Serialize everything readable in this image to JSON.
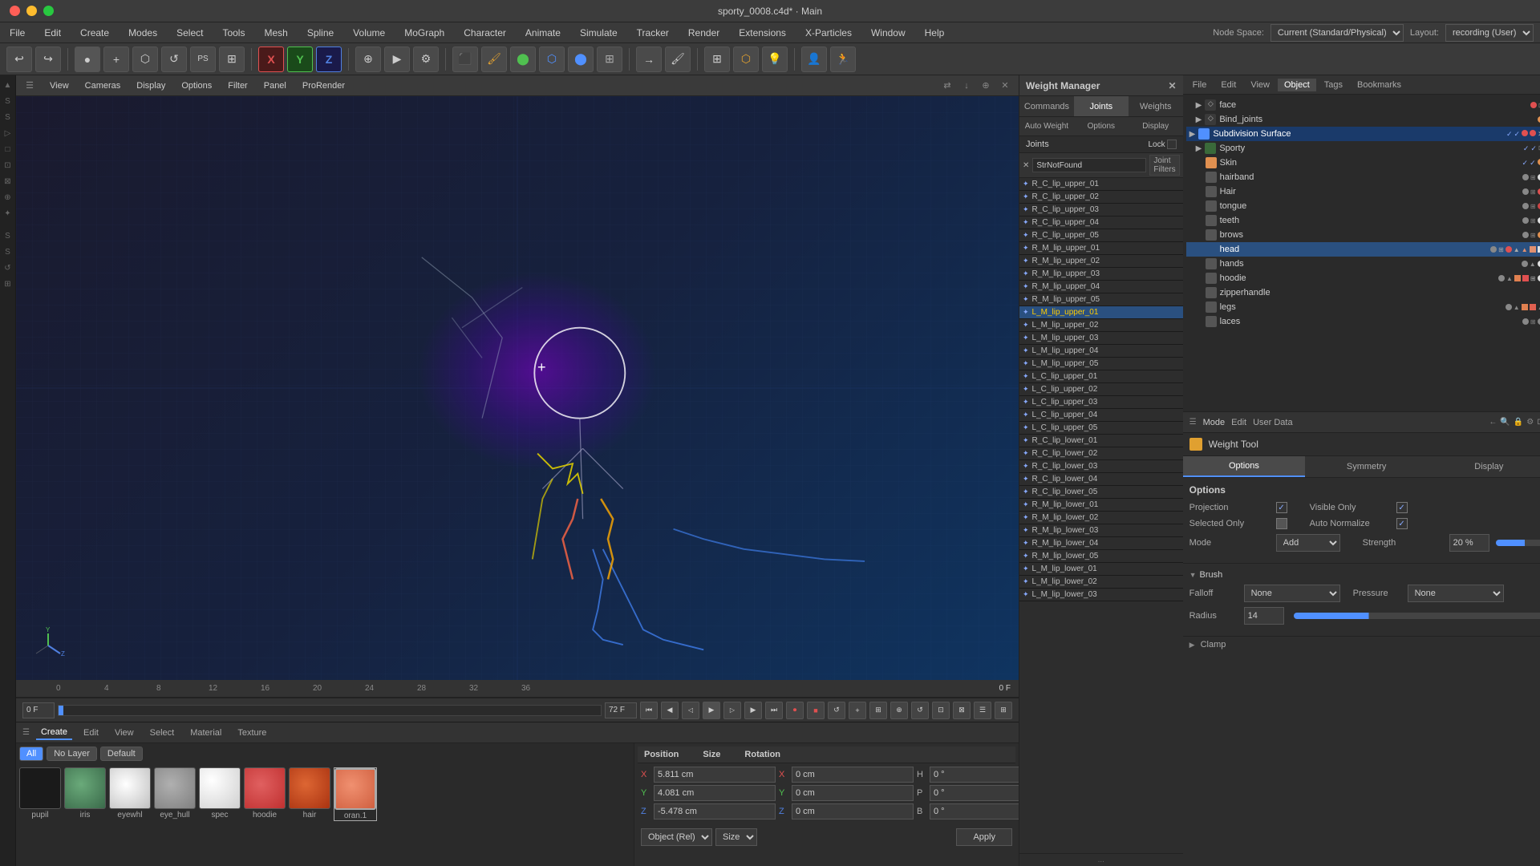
{
  "titleBar": {
    "title": "sporty_0008.c4d* · Main"
  },
  "menuBar": {
    "items": [
      "File",
      "Edit",
      "Create",
      "Modes",
      "Select",
      "Tools",
      "Mesh",
      "Spline",
      "Volume",
      "MoGraph",
      "Character",
      "Animate",
      "Simulate",
      "Tracker",
      "Render",
      "Extensions",
      "X-Particles",
      "Window",
      "Help"
    ],
    "nodeSpaceLabel": "Node Space:",
    "nodeSpaceValue": "Current (Standard/Physical)",
    "layoutLabel": "Layout:",
    "layoutValue": "recording (User)"
  },
  "viewport": {
    "menuItems": [
      "View",
      "Cameras",
      "Display",
      "Options",
      "Filter",
      "Panel",
      "ProRender"
    ],
    "frameIndicator": "0 F"
  },
  "weightManager": {
    "title": "Weight Manager",
    "tabs": [
      "Commands",
      "Joints",
      "Weights"
    ],
    "activeTab": "Joints",
    "subTabs": [
      "Auto Weight",
      "Options",
      "Display"
    ],
    "jointsLabel": "Joints",
    "lockLabel": "Lock",
    "filterPlaceholder": "StrNotFound",
    "jointFilterBtn": "Joint Filters",
    "joints": [
      "R_C_lip_upper_01",
      "R_C_lip_upper_02",
      "R_C_lip_upper_03",
      "R_C_lip_upper_04",
      "R_C_lip_upper_05",
      "R_M_lip_upper_01",
      "R_M_lip_upper_02",
      "R_M_lip_upper_03",
      "R_M_lip_upper_04",
      "R_M_lip_upper_05",
      "L_M_lip_upper_01",
      "L_M_lip_upper_02",
      "L_M_lip_upper_03",
      "L_M_lip_upper_04",
      "L_M_lip_upper_05",
      "L_C_lip_upper_01",
      "L_C_lip_upper_02",
      "L_C_lip_upper_03",
      "L_C_lip_upper_04",
      "L_C_lip_upper_05",
      "R_C_lip_lower_01",
      "R_C_lip_lower_02",
      "R_C_lip_lower_03",
      "R_C_lip_lower_04",
      "R_C_lip_lower_05",
      "R_M_lip_lower_01",
      "R_M_lip_lower_02",
      "R_M_lip_lower_03",
      "R_M_lip_lower_04",
      "R_M_lip_lower_05",
      "L_M_lip_lower_01",
      "L_M_lip_lower_02",
      "L_M_lip_lower_03"
    ],
    "selectedJoint": "L_M_lip_upper_01"
  },
  "objectPanel": {
    "tabs": [
      "File",
      "Edit",
      "View",
      "Object",
      "Tags",
      "Bookmarks"
    ],
    "treeItems": [
      {
        "label": "face",
        "level": 1,
        "type": "null",
        "color": "red"
      },
      {
        "label": "Bind_joints",
        "level": 1,
        "type": "null",
        "color": "orange"
      },
      {
        "label": "Subdivision Surface",
        "level": 0,
        "type": "subdiv",
        "active": true
      },
      {
        "label": "Sporty",
        "level": 1,
        "type": "null",
        "color": "green"
      },
      {
        "label": "Skin",
        "level": 2,
        "type": "skin"
      },
      {
        "label": "hairband",
        "level": 2,
        "type": "null"
      },
      {
        "label": "Hair",
        "level": 2,
        "type": "null"
      },
      {
        "label": "tongue",
        "level": 2,
        "type": "null"
      },
      {
        "label": "teeth",
        "level": 2,
        "type": "null"
      },
      {
        "label": "brows",
        "level": 2,
        "type": "null"
      },
      {
        "label": "head",
        "level": 2,
        "type": "null",
        "selected": true
      },
      {
        "label": "hands",
        "level": 2,
        "type": "null"
      },
      {
        "label": "hoodie",
        "level": 2,
        "type": "null"
      },
      {
        "label": "zipperhandle",
        "level": 2,
        "type": "null"
      },
      {
        "label": "legs",
        "level": 2,
        "type": "null"
      },
      {
        "label": "laces",
        "level": 2,
        "type": "null"
      }
    ]
  },
  "weightTool": {
    "title": "Weight Tool",
    "tabs": [
      "Options",
      "Symmetry",
      "Display"
    ],
    "activeTab": "Options",
    "modeLabel": "Mode",
    "editLabel": "Edit",
    "userDataLabel": "User Data",
    "optionsSection": {
      "title": "Options",
      "projectionLabel": "Projection",
      "projectionChecked": true,
      "visibleOnlyLabel": "Visible Only",
      "visibleOnlyChecked": true,
      "selectedOnlyLabel": "Selected Only",
      "selectedOnlyChecked": false,
      "autoNormalizeLabel": "Auto Normalize",
      "autoNormalizeChecked": true,
      "modeLabel": "Mode",
      "modeValue": "Add",
      "strengthLabel": "Strength",
      "strengthValue": "20 %"
    },
    "brushSection": {
      "title": "Brush",
      "falloffLabel": "Falloff",
      "falloffValue": "None",
      "pressureLabel": "Pressure",
      "pressureValue": "None",
      "radiusLabel": "Radius",
      "radiusValue": "14"
    },
    "clampLabel": "Clamp"
  },
  "timeline": {
    "markers": [
      "0",
      "4",
      "8",
      "12",
      "16",
      "20",
      "24",
      "28",
      "32",
      "36"
    ],
    "currentFrame": "0 F",
    "endFrame": "72 F"
  },
  "bottomPanel": {
    "tabs": [
      "Create",
      "Edit",
      "View",
      "Select",
      "Material",
      "Texture"
    ],
    "activeTab": "Create",
    "filterBtns": [
      "All",
      "No Layer",
      "Default"
    ],
    "activeFilter": "All",
    "materials": [
      {
        "name": "pupil",
        "color": "#1a1a1a"
      },
      {
        "name": "iris",
        "color": "#5a8a6a"
      },
      {
        "name": "eyewhl",
        "color": "#d0d0d0"
      },
      {
        "name": "eye_hull",
        "color": "#a0a0a0"
      },
      {
        "name": "spec",
        "color": "#c0c0c0"
      },
      {
        "name": "hoodie",
        "color": "#d05050"
      },
      {
        "name": "hair",
        "color": "#cc5533"
      },
      {
        "name": "oran.1",
        "color": "#e08060"
      }
    ]
  },
  "transformPanel": {
    "positionLabel": "Position",
    "sizeLabel": "Size",
    "rotationLabel": "Rotation",
    "position": {
      "x": "5.811 cm",
      "y": "4.081 cm",
      "z": "-5.478 cm"
    },
    "size": {
      "x": "0 cm",
      "y": "0 cm",
      "z": "0 cm"
    },
    "rotation": {
      "h": "0 °",
      "p": "0 °",
      "b": "0 °"
    },
    "coordSystem": "Object (Rel)",
    "applyLabel": "Apply"
  },
  "icons": {
    "close": "✕",
    "arrow_left": "←",
    "arrow_right": "→",
    "triangle": "▶",
    "triangle_down": "▼",
    "triangle_right": "▶",
    "circle": "●",
    "play": "▶",
    "pause": "⏸",
    "stop": "■",
    "skip_start": "⏮",
    "skip_end": "⏭",
    "prev": "◀",
    "next": "▶",
    "record": "⏺",
    "bone_icon": "✦",
    "lock": "🔒"
  }
}
